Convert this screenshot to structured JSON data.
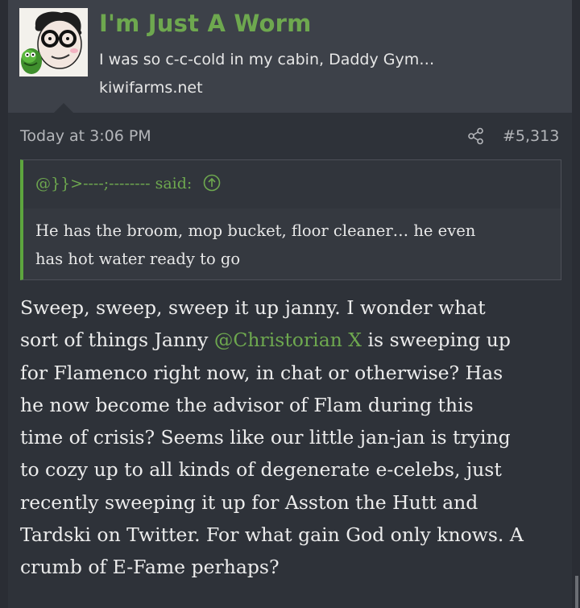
{
  "user": {
    "name": "I'm Just A Worm",
    "title": "I was so c-c-cold in my cabin, Daddy Gym…",
    "site": "kiwifarms.net",
    "avatar_icon": "cartoon-avatar-icon"
  },
  "message": {
    "date": "Today at 3:06 PM",
    "post_number": "#5,313",
    "share_icon": "share-icon"
  },
  "quote": {
    "author": "@}}>----;--------",
    "said_label": "said:",
    "line1": "He has the broom, mop bucket, floor cleaner… he even",
    "line2": "has hot water ready to go",
    "jump_icon": "arrow-up-circle-icon"
  },
  "post": {
    "line1": "Sweep, sweep, sweep it up janny. I wonder what",
    "line2_pre": "sort of things Janny ",
    "mention": "@Christorian X",
    "line2_post": " is sweeping up",
    "line3": "for Flamenco right now, in chat or otherwise? Has",
    "line4": "he now become the advisor of Flam during this",
    "line5": "time of crisis? Seems like our little jan-jan is trying",
    "line6": "to cozy up to all kinds of degenerate e-celebs, just",
    "line7": "recently sweeping it up for Asston the Hutt and",
    "line8": "Tardski on Twitter. For what gain God only knows. A",
    "line9": "crumb of E-Fame perhaps?"
  },
  "colors": {
    "accent": "#6ea84f",
    "background": "#2a2d34",
    "header_bg": "#3d4149",
    "message_bg": "#2e3239"
  }
}
